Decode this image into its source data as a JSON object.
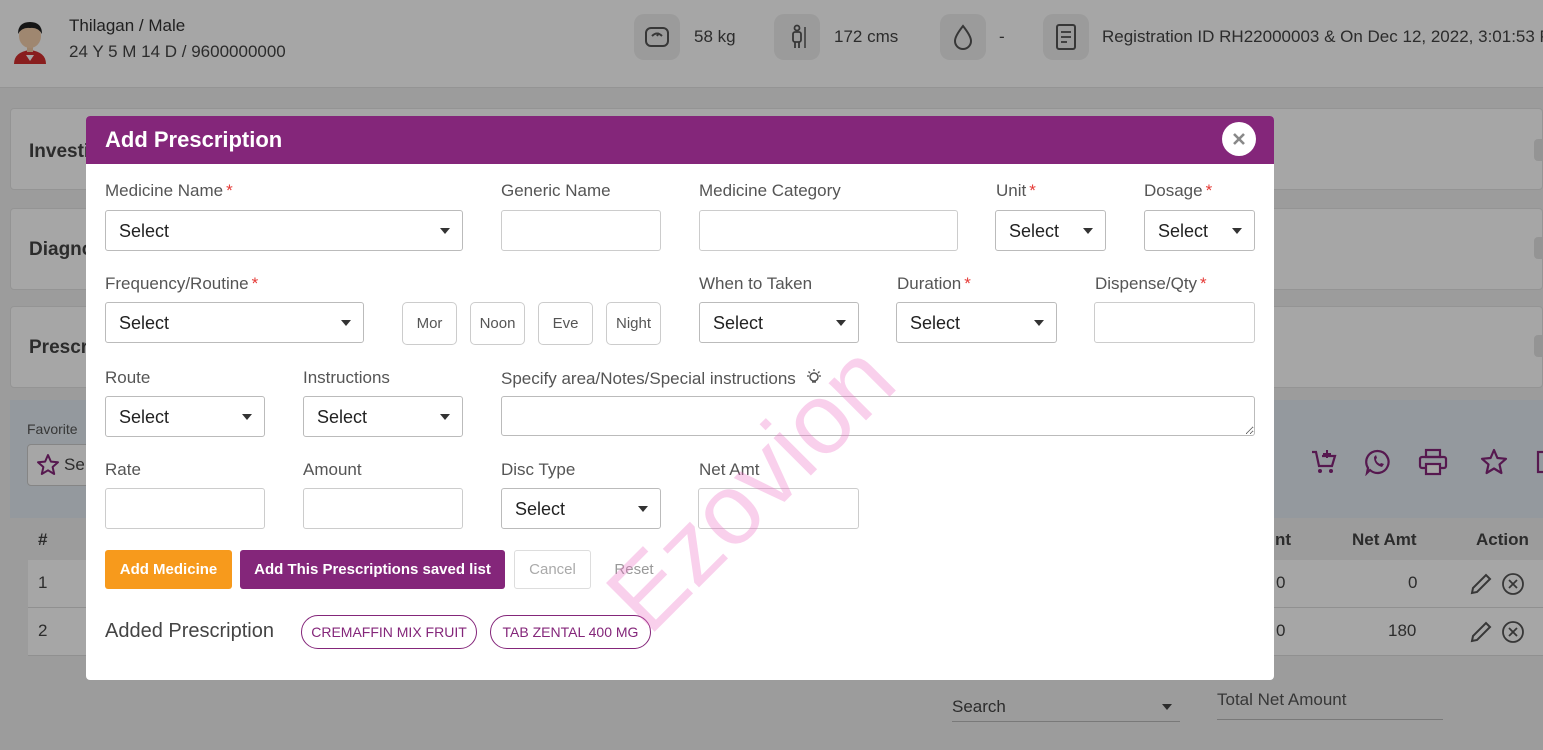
{
  "patient": {
    "name_line": "Thilagan / Male",
    "meta_line": "24 Y 5 M 14 D / 9600000000"
  },
  "vitals": {
    "weight": "58 kg",
    "height": "172 cms",
    "blood_group": "-",
    "registration": "Registration ID RH22000003 & On Dec 12, 2022, 3:01:53 P"
  },
  "background": {
    "cards": [
      "Investi",
      "Diagno",
      "Prescr"
    ],
    "favorites_label": "Favorite",
    "favorites_button": "Se",
    "table": {
      "headers": {
        "num": "#",
        "amt_partial": "nt",
        "net_amt": "Net Amt",
        "action": "Action"
      },
      "rows": [
        {
          "num": "1",
          "amt": "0",
          "net": "0"
        },
        {
          "num": "2",
          "amt": "0",
          "net": "180"
        }
      ]
    },
    "search_label": "Search",
    "total_label": "Total Net Amount"
  },
  "modal": {
    "title": "Add Prescription",
    "required_mark": "*",
    "select_text": "Select",
    "labels": {
      "medicine_name": "Medicine Name",
      "generic_name": "Generic Name",
      "medicine_category": "Medicine Category",
      "unit": "Unit",
      "dosage": "Dosage",
      "frequency": "Frequency/Routine",
      "when_to_taken": "When to Taken",
      "duration": "Duration",
      "dispense_qty": "Dispense/Qty",
      "route": "Route",
      "instructions": "Instructions",
      "notes": "Specify area/Notes/Special instructions",
      "rate": "Rate",
      "amount": "Amount",
      "disc_type": "Disc Type",
      "net_amt": "Net Amt"
    },
    "times": [
      "Mor",
      "Noon",
      "Eve",
      "Night"
    ],
    "buttons": {
      "add_medicine": "Add Medicine",
      "add_saved": "Add This Prescriptions saved list",
      "cancel": "Cancel",
      "reset": "Reset"
    },
    "added_label": "Added Prescription",
    "added_items": [
      "CREMAFFIN MIX FRUIT",
      "TAB ZENTAL 400 MG"
    ]
  },
  "watermark": "Ezovion",
  "colors": {
    "brand_purple": "#84267a",
    "accent_orange": "#f79a1c",
    "required_red": "#e53935"
  }
}
